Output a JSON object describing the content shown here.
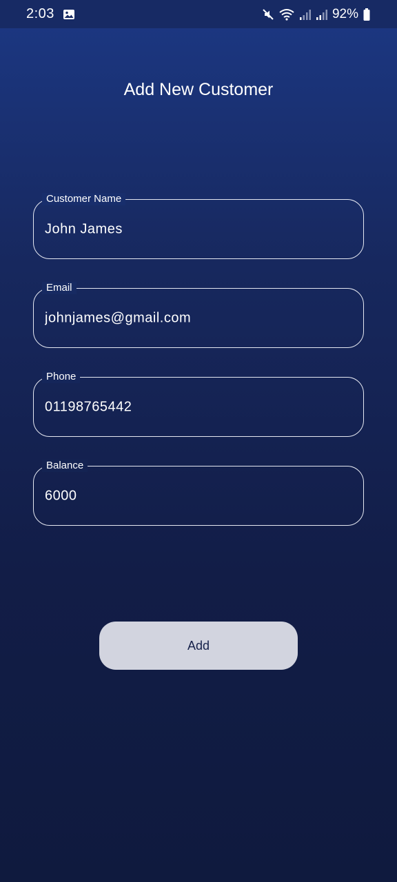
{
  "status_bar": {
    "time": "2:03",
    "battery_percent": "92%",
    "icons": [
      "image-icon",
      "mute-icon",
      "wifi-icon",
      "signal-icon",
      "signal-icon",
      "battery-icon"
    ]
  },
  "page": {
    "title": "Add New Customer"
  },
  "form": {
    "fields": [
      {
        "label": "Customer Name",
        "value": "John James"
      },
      {
        "label": "Email",
        "value": "johnjames@gmail.com"
      },
      {
        "label": "Phone",
        "value": "01198765442"
      },
      {
        "label": "Balance",
        "value": "6000"
      }
    ],
    "submit_label": "Add"
  },
  "colors": {
    "background_top": "#1c3884",
    "background_bottom": "#0f1a3e",
    "field_border": "#e6e9f2",
    "button_bg": "#d2d4df",
    "button_text": "#16214a"
  }
}
